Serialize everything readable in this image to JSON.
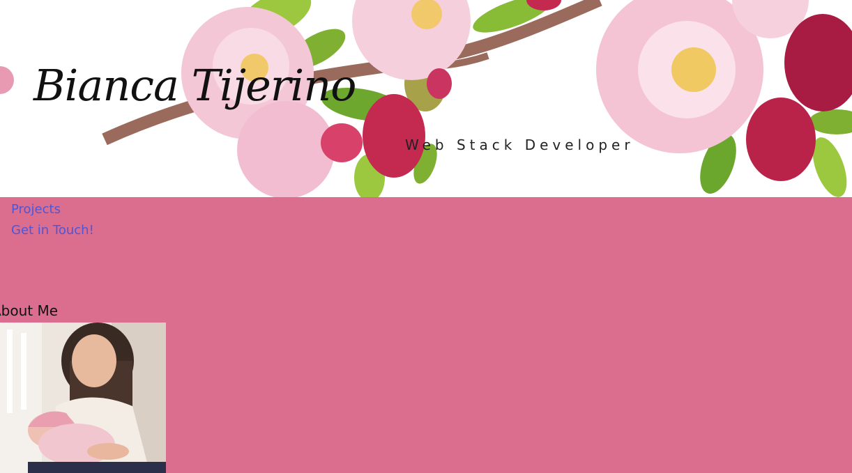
{
  "header": {
    "title": "Bianca Tijerino",
    "subtitle": "Web Stack Developer"
  },
  "nav": {
    "items": [
      {
        "label": "Projects"
      },
      {
        "label": "Get in Touch!"
      }
    ]
  },
  "about": {
    "heading": "About Me"
  },
  "colors": {
    "page_background": "#db6d8f",
    "link": "#4b57d8",
    "header_background": "#ffffff"
  }
}
